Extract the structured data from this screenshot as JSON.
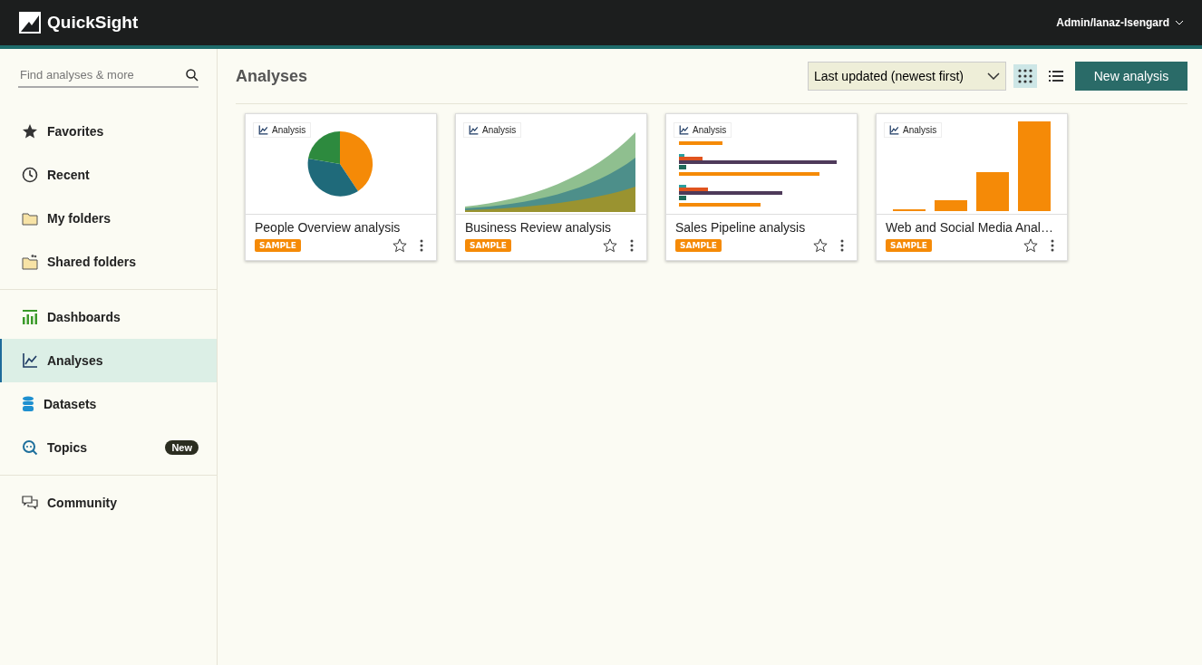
{
  "header": {
    "logo": "QuickSight",
    "user": "Admin/lanaz-Isengard"
  },
  "sidebar": {
    "search": {
      "placeholder": "Find analyses & more"
    },
    "groups": [
      [
        {
          "kind": "star",
          "label": "Favorites",
          "selected": false
        },
        {
          "kind": "clock",
          "label": "Recent",
          "selected": false
        },
        {
          "kind": "folder",
          "label": "My folders",
          "selected": false
        },
        {
          "kind": "shared",
          "label": "Shared folders",
          "selected": false
        }
      ],
      [
        {
          "kind": "dashboard",
          "label": "Dashboards",
          "selected": false
        },
        {
          "kind": "analysis",
          "label": "Analyses",
          "selected": true
        },
        {
          "kind": "dataset",
          "label": "Datasets",
          "selected": false
        },
        {
          "kind": "topic",
          "label": "Topics",
          "selected": false,
          "badge": "New"
        }
      ],
      [
        {
          "kind": "community",
          "label": "Community",
          "selected": false
        }
      ]
    ]
  },
  "main": {
    "title": "Analyses",
    "sort": "Last updated (newest first)",
    "view_modes": [
      {
        "kind": "grid",
        "selected": true
      },
      {
        "kind": "list",
        "selected": false
      }
    ],
    "new_button": "New analysis",
    "cards": [
      {
        "kind": "pie",
        "tag": "Analysis",
        "title": "People Overview analysis",
        "badge": "SAMPLE",
        "favorite": false
      },
      {
        "kind": "area",
        "tag": "Analysis",
        "title": "Business Review analysis",
        "badge": "SAMPLE",
        "favorite": false
      },
      {
        "kind": "hbar",
        "tag": "Analysis",
        "title": "Sales Pipeline analysis",
        "badge": "SAMPLE",
        "favorite": false
      },
      {
        "kind": "bar",
        "tag": "Analysis",
        "title": "Web and Social Media Anal…",
        "badge": "SAMPLE",
        "favorite": false
      }
    ]
  }
}
